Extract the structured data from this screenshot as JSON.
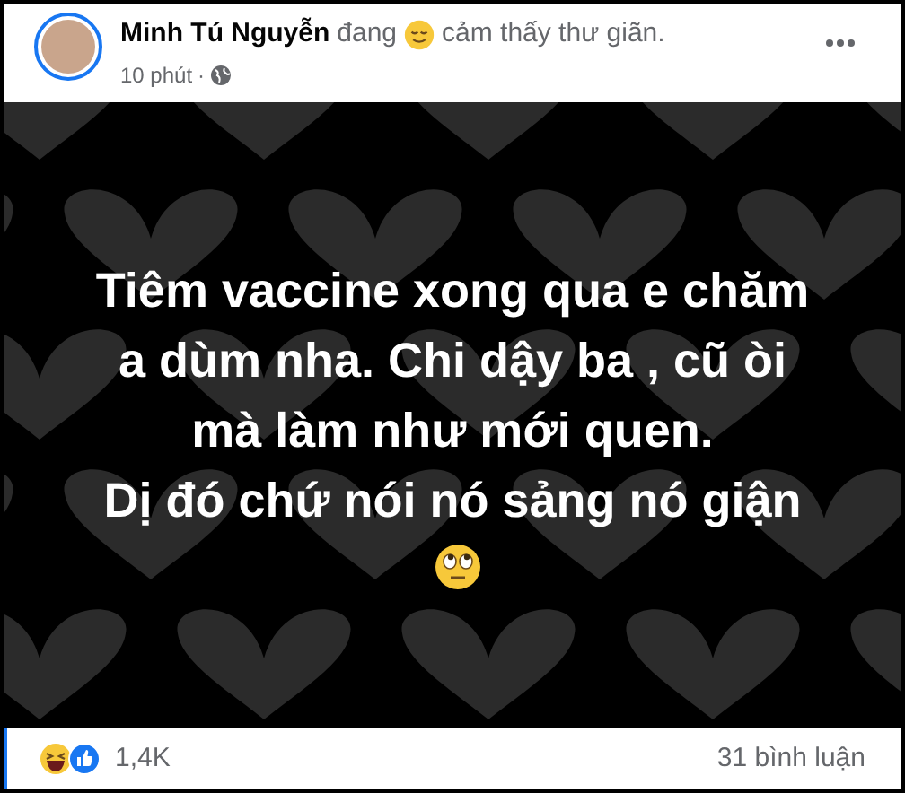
{
  "post": {
    "author": "Minh Tú Nguyễn",
    "activity_before": "đang",
    "activity_after": "cảm thấy thư giãn.",
    "time": "10 phút",
    "separator": "·",
    "body_lines": [
      "Tiêm vaccine xong qua e chăm",
      "a dùm nha. Chi dậy ba , cũ òi",
      "mà làm như mới quen.",
      "Dị đó chứ nói nó sảng nó giận"
    ],
    "reactions_count": "1,4K",
    "comments": "31 bình luận"
  }
}
